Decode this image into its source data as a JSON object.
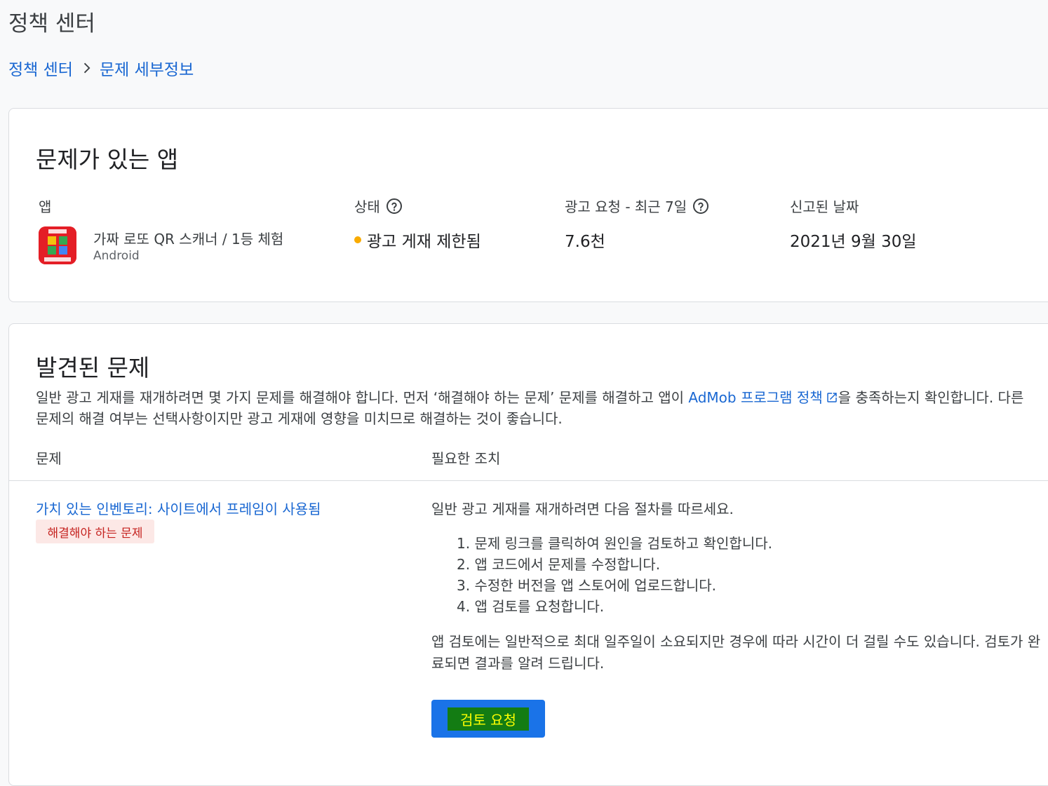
{
  "page": {
    "title": "정책 센터"
  },
  "breadcrumb": {
    "root": "정책 센터",
    "current": "문제 세부정보"
  },
  "app_card": {
    "title": "문제가 있는 앱",
    "columns": {
      "app": "앱",
      "status": "상태",
      "ad_requests": "광고 요청 - 최근 7일",
      "reported_date": "신고된 날짜"
    },
    "app": {
      "name": "가짜 로또 QR 스캐너 / 1등 체험",
      "platform": "Android"
    },
    "status_text": "광고 게재 제한됨",
    "status_color": "#f9ab00",
    "ad_requests_value": "7.6천",
    "reported_date_value": "2021년 9월 30일"
  },
  "issues_card": {
    "title": "발견된 문제",
    "desc_part1": "일반 광고 게재를 재개하려면 몇 가지 문제를 해결해야 합니다. 먼저 ‘해결해야 하는 문제’ 문제를 해결하고 앱이 ",
    "policy_link": "AdMob 프로그램 정책",
    "desc_part2": "을 충족하는지 확인합니다. 다른 문제의 해결 여부는 선택사항이지만 광고 게재에 영향을 미치므로 해결하는 것이 좋습니다.",
    "table_headers": {
      "issue": "문제",
      "action": "필요한 조치"
    },
    "issue": {
      "title": "가치 있는 인벤토리: 사이트에서 프레임이 사용됨",
      "badge": "해결해야 하는 문제"
    },
    "action": {
      "intro": "일반 광고 게재를 재개하려면 다음 절차를 따르세요.",
      "steps": [
        "1. 문제 링크를 클릭하여 원인을 검토하고 확인합니다.",
        "2. 앱 코드에서 문제를 수정합니다.",
        "3. 수정한 버전을 앱 스토어에 업로드합니다.",
        "4. 앱 검토를 요청합니다."
      ],
      "note": "앱 검토에는 일반적으로 최대 일주일이 소요되지만 경우에 따라 시간이 더 걸릴 수도 있습니다. 검토가 완료되면 결과를 알려 드립니다.",
      "button": "검토 요청"
    }
  }
}
